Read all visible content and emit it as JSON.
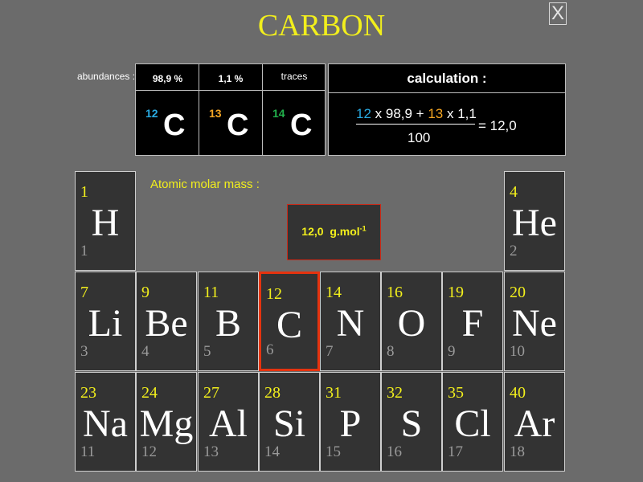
{
  "title": "CARBON",
  "close_label": "X",
  "abundances": {
    "label": "abundances :",
    "isotopes": [
      {
        "percent": "98,9 %",
        "mass": "12",
        "symbol": "C",
        "mass_color": "#29a9e0"
      },
      {
        "percent": "1,1 %",
        "mass": "13",
        "symbol": "C",
        "mass_color": "#f5a623"
      },
      {
        "percent": "traces",
        "mass": "14",
        "symbol": "C",
        "mass_color": "#22b14c"
      }
    ]
  },
  "calculation": {
    "heading": "calculation :",
    "term1_mass": "12",
    "term1_rest": " x 98,9 + ",
    "term2_mass": "13",
    "term2_rest": " x 1,1",
    "denominator": "100",
    "result": "= 12,0"
  },
  "molar": {
    "label": "Atomic molar mass :",
    "value": "12,0",
    "unit": "g.mol",
    "exponent": "-1"
  },
  "elements": [
    {
      "symbol": "H",
      "mass": "1",
      "number": "1"
    },
    {
      "symbol": "He",
      "mass": "4",
      "number": "2"
    },
    {
      "symbol": "Li",
      "mass": "7",
      "number": "3"
    },
    {
      "symbol": "Be",
      "mass": "9",
      "number": "4"
    },
    {
      "symbol": "B",
      "mass": "11",
      "number": "5"
    },
    {
      "symbol": "C",
      "mass": "12",
      "number": "6"
    },
    {
      "symbol": "N",
      "mass": "14",
      "number": "7"
    },
    {
      "symbol": "O",
      "mass": "16",
      "number": "8"
    },
    {
      "symbol": "F",
      "mass": "19",
      "number": "9"
    },
    {
      "symbol": "Ne",
      "mass": "20",
      "number": "10"
    },
    {
      "symbol": "Na",
      "mass": "23",
      "number": "11"
    },
    {
      "symbol": "Mg",
      "mass": "24",
      "number": "12"
    },
    {
      "symbol": "Al",
      "mass": "27",
      "number": "13"
    },
    {
      "symbol": "Si",
      "mass": "28",
      "number": "14"
    },
    {
      "symbol": "P",
      "mass": "31",
      "number": "15"
    },
    {
      "symbol": "S",
      "mass": "32",
      "number": "16"
    },
    {
      "symbol": "Cl",
      "mass": "35",
      "number": "17"
    },
    {
      "symbol": "Ar",
      "mass": "40",
      "number": "18"
    }
  ],
  "selected_element": "C",
  "colors": {
    "mass": "#f2ef1c",
    "highlight": "#e5330f",
    "cell": "#333333",
    "background": "#6b6b6b"
  }
}
